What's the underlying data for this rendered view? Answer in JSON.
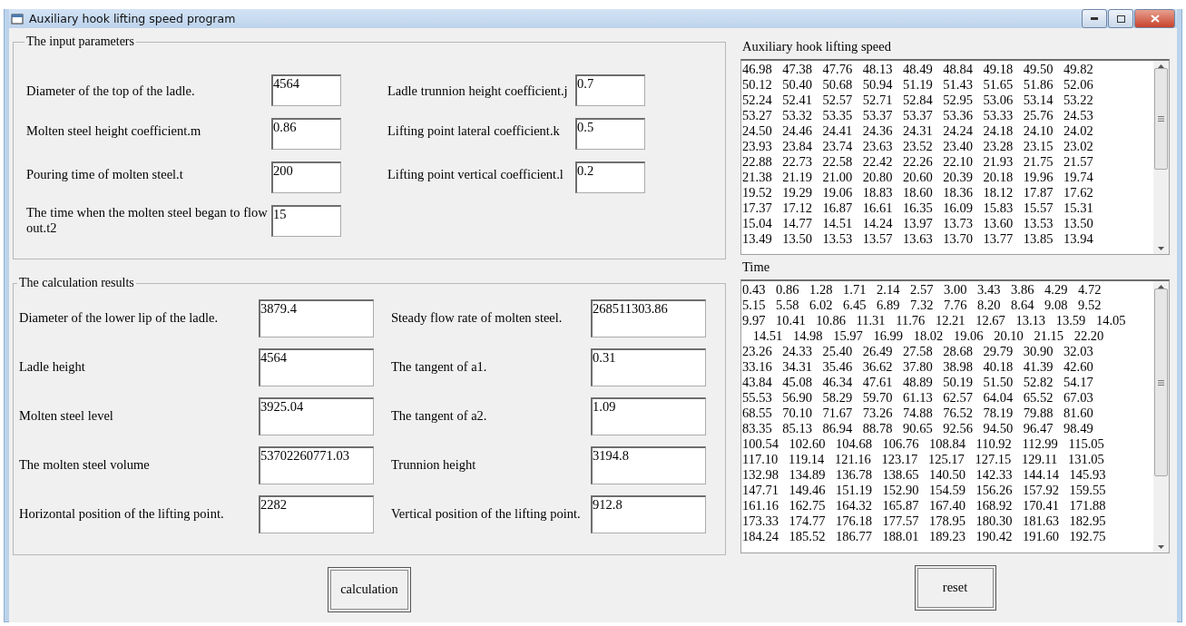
{
  "window": {
    "title": "Auxiliary hook lifting speed program"
  },
  "input_group": {
    "title": "The input parameters",
    "fields": [
      {
        "label": "Diameter of the top of the ladle.",
        "value": "4564"
      },
      {
        "label": "Ladle trunnion height coefficient.j",
        "value": "0.7"
      },
      {
        "label": "Molten steel height coefficient.m",
        "value": "0.86"
      },
      {
        "label": "Lifting point lateral coefficient.k",
        "value": "0.5"
      },
      {
        "label": "Pouring time of molten steel.t",
        "value": "200"
      },
      {
        "label": "Lifting point vertical coefficient.l",
        "value": "0.2"
      },
      {
        "label": "The time when the molten steel began to flow out.t2",
        "value": "15"
      }
    ]
  },
  "results_group": {
    "title": "The calculation results",
    "fields": [
      {
        "label": "Diameter of the lower lip of the ladle.",
        "value": "3879.4"
      },
      {
        "label": "Steady flow rate of molten steel.",
        "value": "268511303.86"
      },
      {
        "label": "Ladle height",
        "value": "4564"
      },
      {
        "label": "The tangent of a1.",
        "value": "0.31"
      },
      {
        "label": "Molten steel level",
        "value": "3925.04"
      },
      {
        "label": "The tangent of a2.",
        "value": "1.09"
      },
      {
        "label": "The molten steel volume",
        "value": "53702260771.03"
      },
      {
        "label": "Trunnion height",
        "value": "3194.8"
      },
      {
        "label": "Horizontal position of the lifting point.",
        "value": "2282"
      },
      {
        "label": "Vertical position of the lifting point.",
        "value": "912.8"
      }
    ]
  },
  "speed_output": {
    "label": "Auxiliary hook lifting speed",
    "lines": [
      "46.98 47.38 47.76 48.13 48.49 48.84 49.18 49.50 49.82",
      "50.12 50.40 50.68 50.94 51.19 51.43 51.65 51.86 52.06",
      "52.24 52.41 52.57 52.71 52.84 52.95 53.06 53.14 53.22",
      "53.27 53.32 53.35 53.37 53.37 53.36 53.33 25.76 24.53",
      "24.50 24.46 24.41 24.36 24.31 24.24 24.18 24.10 24.02",
      "23.93 23.84 23.74 23.63 23.52 23.40 23.28 23.15 23.02",
      "22.88 22.73 22.58 22.42 22.26 22.10 21.93 21.75 21.57",
      "21.38 21.19 21.00 20.80 20.60 20.39 20.18 19.96 19.74",
      "19.52 19.29 19.06 18.83 18.60 18.36 18.12 17.87 17.62",
      "17.37 17.12 16.87 16.61 16.35 16.09 15.83 15.57 15.31",
      "15.04 14.77 14.51 14.24 13.97 13.73 13.60 13.53 13.50",
      "13.49 13.50 13.53 13.57 13.63 13.70 13.77 13.85 13.94"
    ]
  },
  "time_output": {
    "label": "Time",
    "lines": [
      "0.43 0.86 1.28 1.71 2.14 2.57 3.00 3.43 3.86 4.29 4.72",
      "5.15 5.58 6.02 6.45 6.89 7.32 7.76 8.20 8.64 9.08 9.52",
      "9.97 10.41 10.86 11.31 11.76 12.21 12.67 13.13 13.59 14.05",
      " 14.51 14.98 15.97 16.99 18.02 19.06 20.10 21.15 22.20",
      "23.26 24.33 25.40 26.49 27.58 28.68 29.79 30.90 32.03",
      "33.16 34.31 35.46 36.62 37.80 38.98 40.18 41.39 42.60",
      "43.84 45.08 46.34 47.61 48.89 50.19 51.50 52.82 54.17",
      "55.53 56.90 58.29 59.70 61.13 62.57 64.04 65.52 67.03",
      "68.55 70.10 71.67 73.26 74.88 76.52 78.19 79.88 81.60",
      "83.35 85.13 86.94 88.78 90.65 92.56 94.50 96.47 98.49",
      "100.54 102.60 104.68 106.76 108.84 110.92 112.99 115.05",
      "117.10 119.14 121.16 123.17 125.17 127.15 129.11 131.05",
      "132.98 134.89 136.78 138.65 140.50 142.33 144.14 145.93",
      "147.71 149.46 151.19 152.90 154.59 156.26 157.92 159.55",
      "161.16 162.75 164.32 165.87 167.40 168.92 170.41 171.88",
      "173.33 174.77 176.18 177.57 178.95 180.30 181.63 182.95",
      "184.24 185.52 186.77 188.01 189.23 190.42 191.60 192.75"
    ]
  },
  "buttons": [
    "calculation",
    "reset"
  ]
}
